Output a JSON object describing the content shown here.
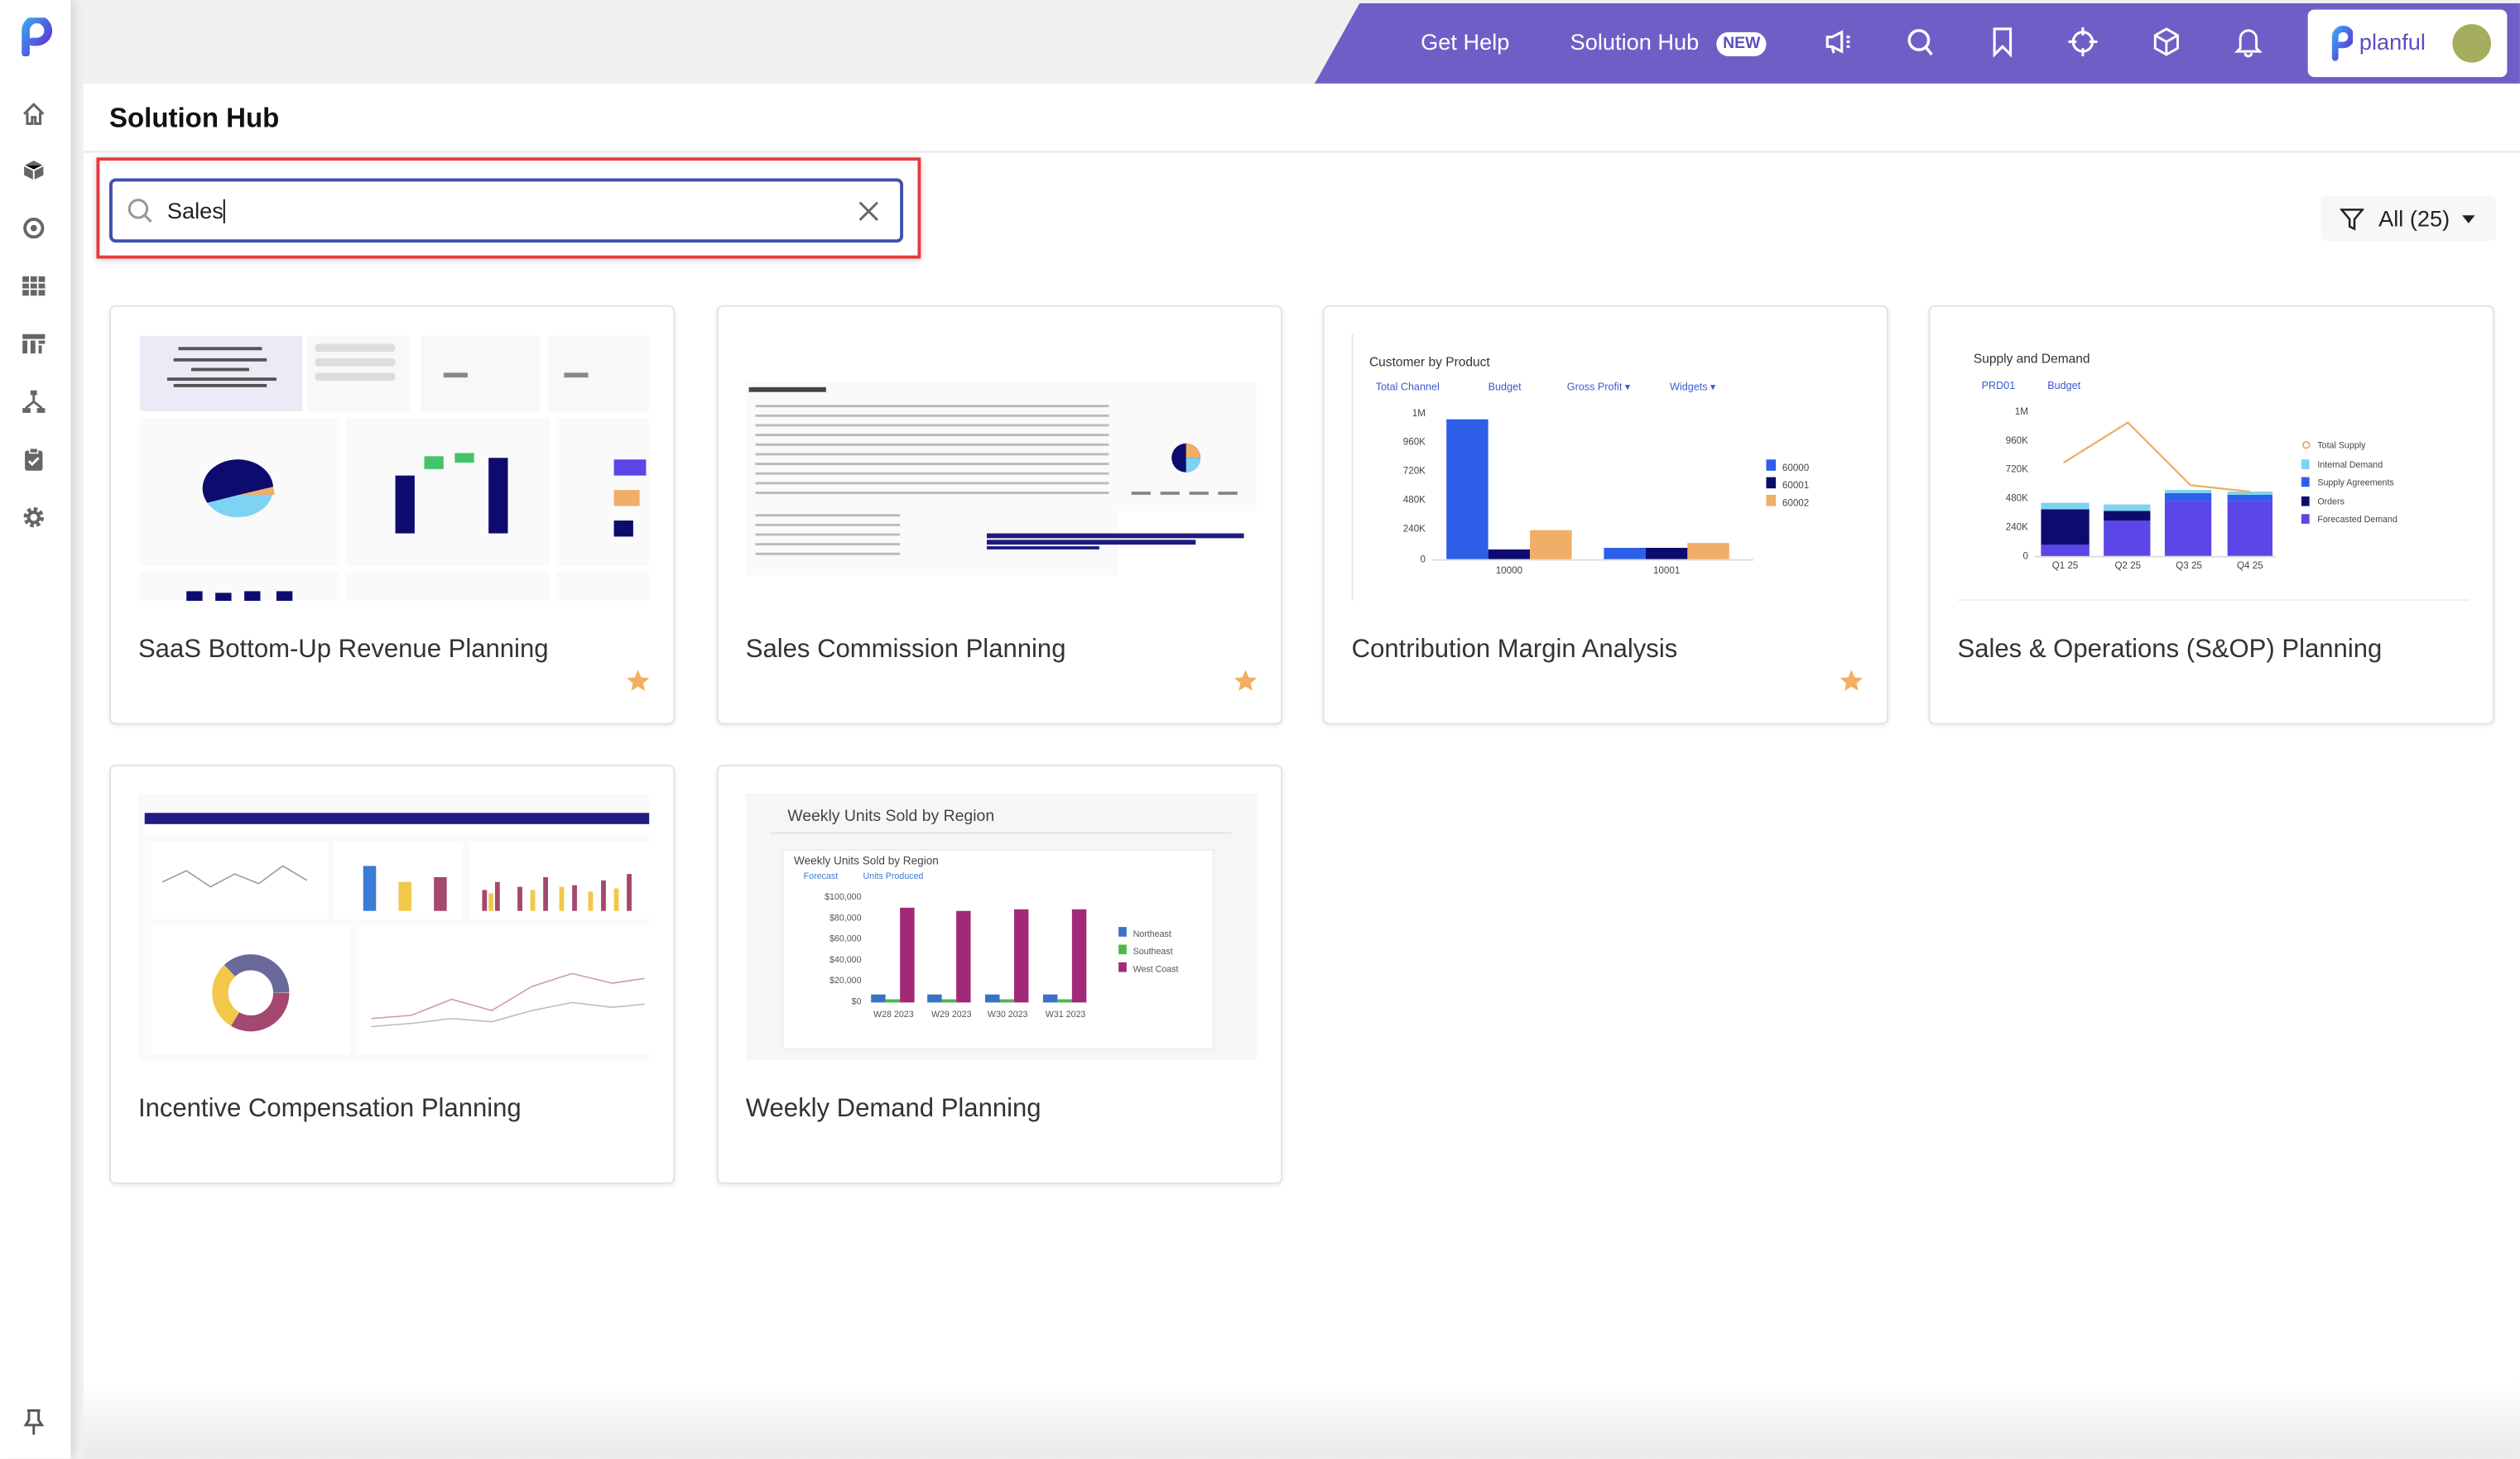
{
  "header": {
    "get_help": "Get Help",
    "solution_hub": "Solution Hub",
    "new_badge": "NEW",
    "icons": [
      "megaphone-icon",
      "search-icon",
      "bookmark-icon",
      "crosshair-icon",
      "cube-icon",
      "bell-icon"
    ],
    "brand": "planful",
    "accent_color": "#6e5fc7"
  },
  "sidebar": {
    "items": [
      "home",
      "cube",
      "target",
      "grid",
      "dashboard",
      "hierarchy",
      "clipboard-check",
      "settings"
    ],
    "pin": "pin"
  },
  "page": {
    "title": "Solution Hub",
    "search": {
      "value": "Sales"
    },
    "filter": {
      "label": "All (25)"
    }
  },
  "cards": [
    {
      "title": "SaaS Bottom-Up Revenue Planning",
      "favorite": true
    },
    {
      "title": "Sales Commission Planning",
      "favorite": true
    },
    {
      "title": "Contribution Margin Analysis",
      "favorite": true,
      "thumb": {
        "title": "Customer by Product",
        "tabs": [
          "Total Channel",
          "Budget",
          "Gross Profit ▾",
          "Widgets ▾"
        ],
        "yticks": [
          "1M",
          "960K",
          "720K",
          "480K",
          "240K",
          "0"
        ],
        "xticks": [
          "10000",
          "10001"
        ],
        "legend": [
          "60000",
          "60001",
          "60002"
        ]
      }
    },
    {
      "title": "Sales & Operations (S&OP) Planning",
      "favorite": false,
      "thumb": {
        "title": "Supply and Demand",
        "tabs": [
          "PRD01",
          "Budget"
        ],
        "yticks": [
          "1M",
          "960K",
          "720K",
          "480K",
          "240K",
          "0"
        ],
        "xticks": [
          "Q1 25",
          "Q2 25",
          "Q3 25",
          "Q4 25"
        ],
        "legend": [
          "Total Supply",
          "Internal Demand",
          "Supply Agreements",
          "Orders",
          "Forecasted Demand"
        ]
      }
    },
    {
      "title": "Incentive Compensation Planning",
      "favorite": false
    },
    {
      "title": "Weekly Demand Planning",
      "favorite": false,
      "thumb": {
        "title": "Weekly Units Sold by Region",
        "inner_title": "Weekly Units Sold by Region",
        "tabs": [
          "Forecast",
          "Units Produced"
        ],
        "yticks": [
          "$100,000",
          "$80,000",
          "$60,000",
          "$40,000",
          "$20,000",
          "$0"
        ],
        "xticks": [
          "W28 2023",
          "W29 2023",
          "W30 2023",
          "W31 2023"
        ],
        "legend": [
          "Northeast",
          "Southeast",
          "West Coast"
        ]
      }
    }
  ]
}
